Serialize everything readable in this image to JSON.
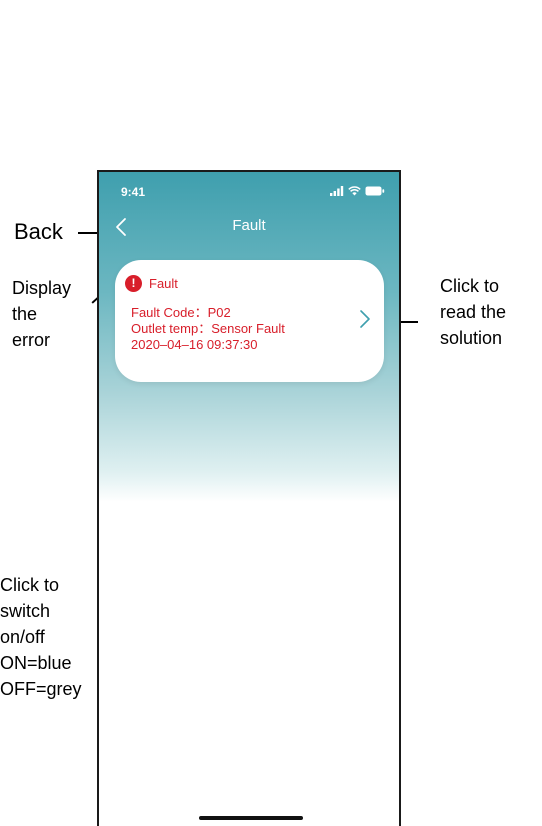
{
  "annotations": {
    "back": "Back",
    "display": [
      "Display",
      "the",
      "error"
    ],
    "solution": [
      "Click to",
      "read the",
      "solution"
    ],
    "switch": [
      "Click to",
      "switch",
      "on/off",
      "ON=blue",
      "OFF=grey"
    ]
  },
  "status_bar": {
    "time": "9:41",
    "icons": [
      "signal-icon",
      "wifi-icon",
      "battery-icon"
    ]
  },
  "nav": {
    "title": "Fault",
    "back_icon": "chevron-left-icon"
  },
  "fault_card": {
    "title": "Fault",
    "lines": [
      "Fault Code：P02",
      "Outlet temp：Sensor Fault",
      "2020–04–16 09:37:30"
    ],
    "icon": "alert-icon",
    "chevron": "chevron-right-icon",
    "color": "#d81e2a"
  },
  "theme": {
    "accent": "#3f9fae",
    "chevron_color": "#3f9fae"
  }
}
